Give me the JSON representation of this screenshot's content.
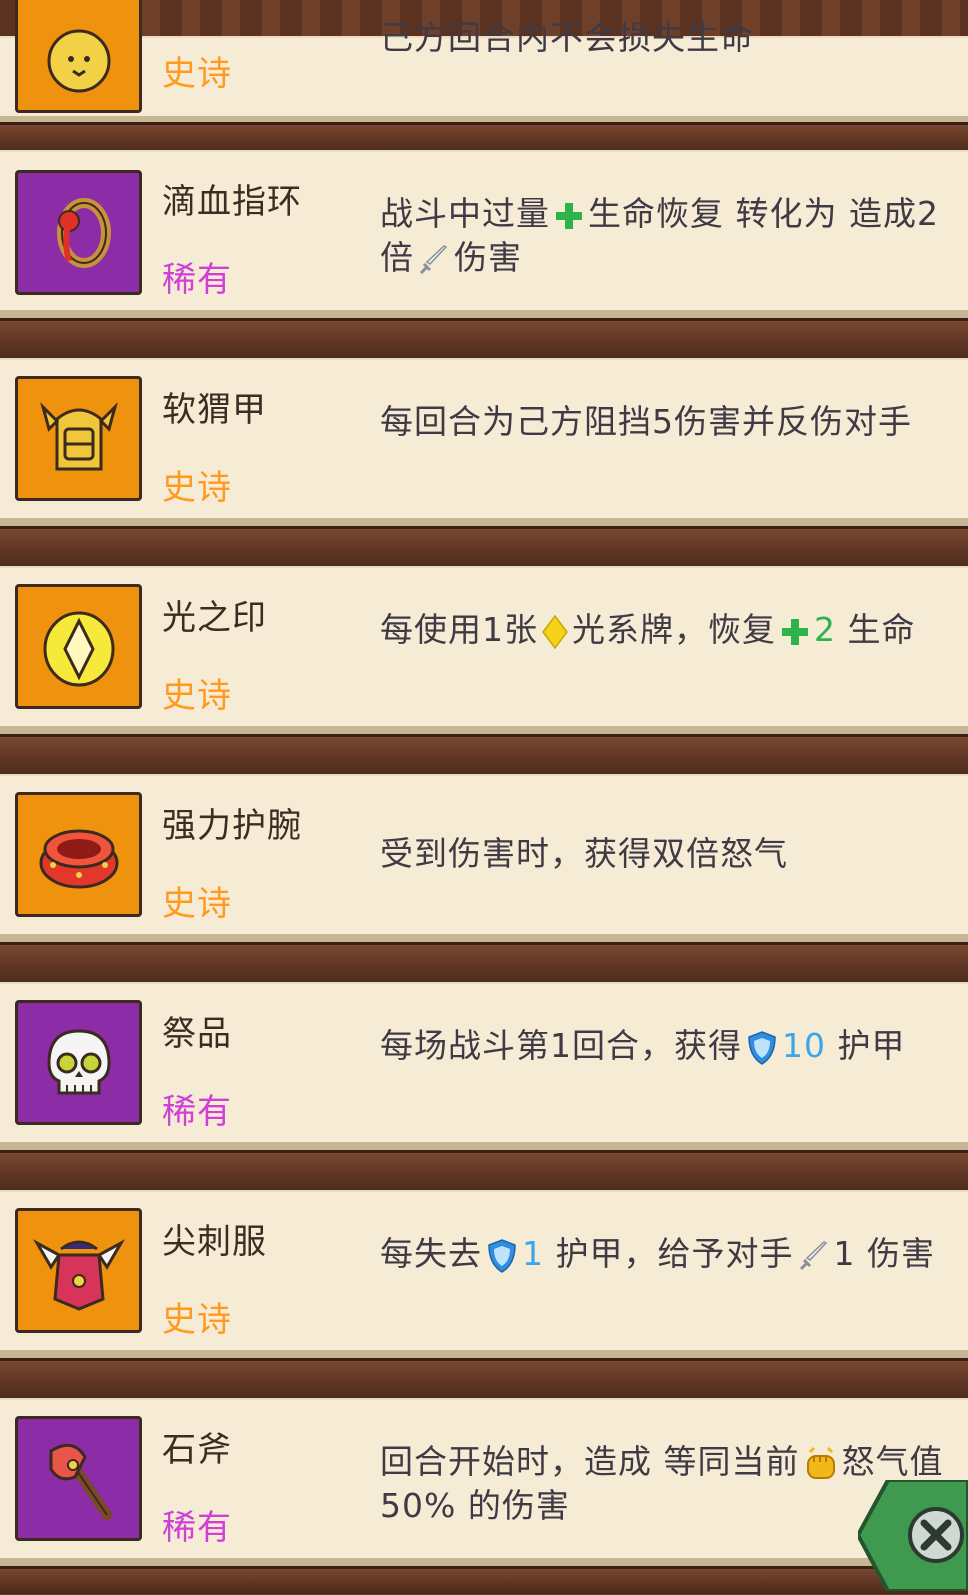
{
  "items": [
    {
      "name": "",
      "rarity": "史诗",
      "rarity_type": "epic",
      "icon": "lion-icon",
      "desc": "己方回合内不会损失生命"
    },
    {
      "name": "滴血指环",
      "rarity": "稀有",
      "rarity_type": "rare",
      "icon": "blood-ring-icon",
      "desc_a": "战斗中过量",
      "desc_b": "生命恢复 转化为 造成2倍",
      "desc_c": "伤害"
    },
    {
      "name": "软猬甲",
      "rarity": "史诗",
      "rarity_type": "epic",
      "icon": "helmet-icon",
      "desc": "每回合为己方阻挡5伤害并反伤对手"
    },
    {
      "name": "光之印",
      "rarity": "史诗",
      "rarity_type": "epic",
      "icon": "light-seal-icon",
      "desc_a": "每使用1张",
      "desc_b": "光系牌，恢复",
      "desc_num": "2",
      "desc_c": "生命"
    },
    {
      "name": "强力护腕",
      "rarity": "史诗",
      "rarity_type": "epic",
      "icon": "bracer-icon",
      "desc": "受到伤害时，获得双倍怒气"
    },
    {
      "name": "祭品",
      "rarity": "稀有",
      "rarity_type": "rare",
      "icon": "skull-icon",
      "desc_a": "每场战斗第1回合，获得",
      "desc_num": "10",
      "desc_c": "护甲"
    },
    {
      "name": "尖刺服",
      "rarity": "史诗",
      "rarity_type": "epic",
      "icon": "spiked-armor-icon",
      "desc_a": "每失去",
      "desc_num": "1",
      "desc_b": "护甲，给予对手",
      "desc_num2": "1",
      "desc_c": "伤害"
    },
    {
      "name": "石斧",
      "rarity": "稀有",
      "rarity_type": "rare",
      "icon": "stone-axe-icon",
      "desc_a": "回合开始时，造成 等同当前",
      "desc_c": "怒气值50% 的伤害"
    }
  ],
  "colors": {
    "epic": "#ef930f",
    "rare": "#8c2ca6",
    "heal": "#2db34a",
    "armor": "#3ba6e8"
  },
  "icons": {
    "heal": "green-plus-icon",
    "damage": "sword-icon",
    "light": "yellow-diamond-icon",
    "armor": "blue-shield-icon",
    "rage": "fist-icon",
    "close": "close-icon"
  }
}
